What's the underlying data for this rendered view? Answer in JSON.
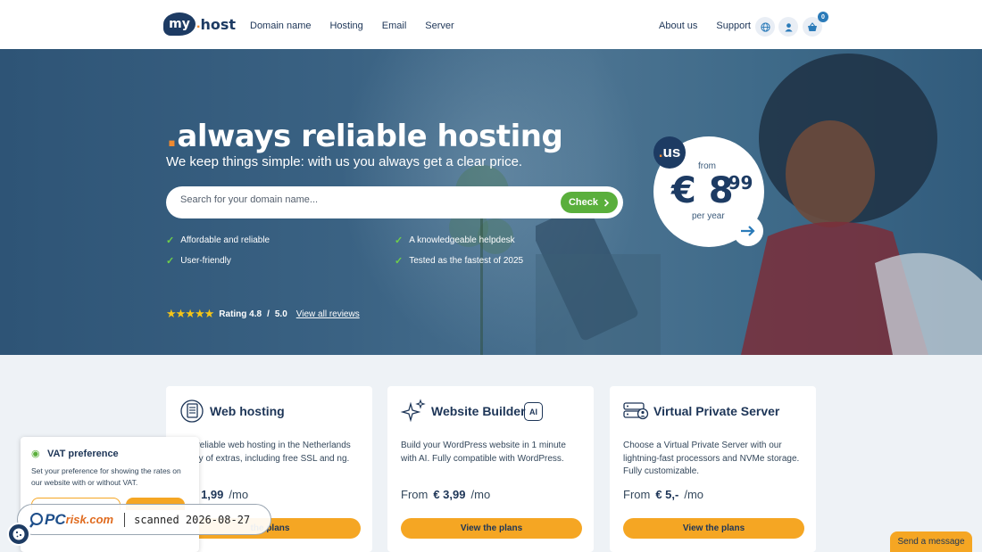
{
  "header": {
    "logo": {
      "bubble": "my",
      "dot": ".",
      "host": "host"
    },
    "nav_left": [
      "Domain name",
      "Hosting",
      "Email",
      "Server"
    ],
    "nav_right": [
      "About us",
      "Support"
    ],
    "cart_count": "0"
  },
  "hero": {
    "title_dot": ".",
    "title": "always reliable hosting",
    "subtitle": "We keep things simple: with us you always get a clear price.",
    "search": {
      "placeholder": "Search for your domain name...",
      "value": "",
      "button": "Check"
    },
    "features": [
      "Affordable and reliable",
      "A knowledgeable helpdesk",
      "User-friendly",
      "Tested as the fastest of 2025"
    ],
    "rating": {
      "label": "Rating 4.8",
      "sep": "/",
      "max": "5.0",
      "link": "View all reviews",
      "stars": 5
    },
    "price": {
      "tld_dot": ".",
      "tld": "us",
      "from": "from",
      "amount": "€ 8",
      "cents": ",99",
      "per": "per year"
    }
  },
  "cards": [
    {
      "title": "Web hosting",
      "desc": "and reliable web hosting in the Netherlands plenty of extras, including free SSL and ng.",
      "from": "n",
      "price": "€ 1,99",
      "unit": "/mo",
      "button": "the plans"
    },
    {
      "title": "Website Builder",
      "badge": "AI",
      "desc": "Build your WordPress website in 1 minute with AI. Fully compatible with WordPress.",
      "from": "From",
      "price": "€ 3,99",
      "unit": "/mo",
      "button": "View the plans"
    },
    {
      "title": "Virtual Private Server",
      "desc": "Choose a Virtual Private Server with our lightning-fast processors and NVMe storage. Fully customizable.",
      "from": "From",
      "price": "€ 5,-",
      "unit": "/mo",
      "button": "View the plans"
    }
  ],
  "vat": {
    "title": "VAT preference",
    "text": "Set your preference for showing the rates on our website with or without VAT."
  },
  "watermark": {
    "pc": "PC",
    "risk": "risk.com",
    "text": "scanned 2026-08-27"
  },
  "send_message": "Send a message",
  "colors": {
    "navy": "#1d3b63",
    "orange": "#f5a623",
    "green": "#5aaf3c",
    "accent_dot": "#f08a30"
  }
}
